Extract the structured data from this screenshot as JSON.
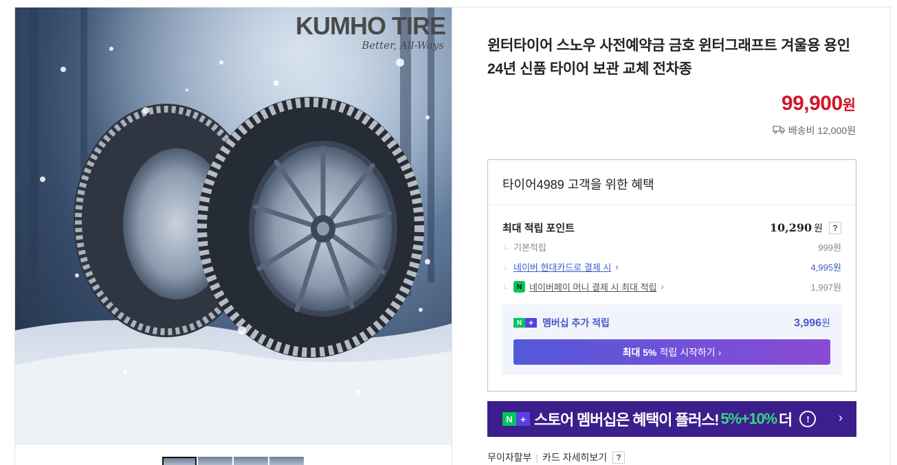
{
  "brand": {
    "name": "KUMHO TIRE",
    "slogan": "Better, All-Ways"
  },
  "product": {
    "title": "윈터타이어 스노우 사전예약금 금호 윈터그래프트 겨울용 용인 24년 신품 타이어 보관 교체 전차종",
    "price": "99,900",
    "price_unit": "원",
    "shipping_label": "배송비 12,000원"
  },
  "benefits": {
    "title": "타이어4989 고객을 위한 혜택",
    "max_points": {
      "label": "최대 적립 포인트",
      "value": "10,290",
      "unit": "원",
      "help": "?"
    },
    "basic": {
      "label": "기본적립",
      "value": "999원"
    },
    "hyundai": {
      "label": "네이버 현대카드로 결제 시",
      "value": "4,995원"
    },
    "npay": {
      "label": "네이버페이 머니 결제 시 최대 적립",
      "value": "1,997원",
      "icon_text": "N"
    },
    "membership": {
      "badge_n": "N",
      "badge_plus": "+",
      "label": "멤버십 추가 적립",
      "value": "3,996",
      "unit": "원",
      "button_bold": "최대 5%",
      "button_text": "적립 시작하기"
    }
  },
  "banner": {
    "text": "스토어 멤버십은 혜택이 플러스!",
    "highlight": "5%+10%",
    "suffix": "더",
    "info": "!"
  },
  "links": {
    "installment": "무이자할부",
    "card_detail": "카드 자세히보기",
    "help": "?"
  },
  "colors": {
    "price": "#d3152a",
    "accent_blue": "#4459c9",
    "naver_green": "#03c75a",
    "banner_bg": "#3b1f8c"
  },
  "icons": [
    "truck-icon",
    "chevron-right-icon",
    "help-icon",
    "info-icon"
  ]
}
